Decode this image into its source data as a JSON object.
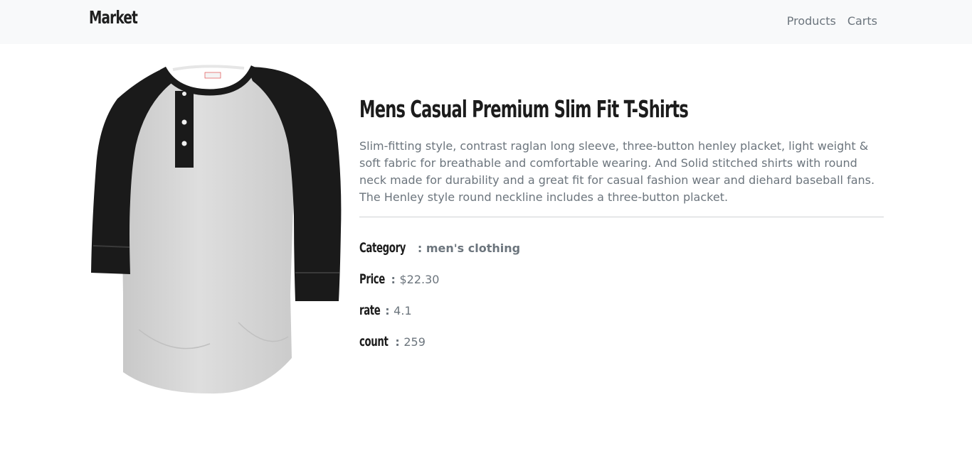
{
  "navbar": {
    "brand": "Market",
    "links": [
      "Products",
      "Carts"
    ]
  },
  "product": {
    "title": "Mens Casual Premium Slim Fit T-Shirts",
    "description": "Slim-fitting style, contrast raglan long sleeve, three-button henley placket, light weight & soft fabric for breathable and comfortable wearing. And Solid stitched shirts with round neck made for durability and a great fit for casual fashion wear and diehard baseball fans. The Henley style round neckline includes a three-button placket.",
    "category_label": "Category",
    "category": "men's clothing",
    "price_label": "Price",
    "price": "$22.30",
    "rate_label": "rate",
    "rate": "4.1",
    "count_label": "count",
    "count": "259",
    "separator": ":",
    "image_icon": "raglan-henley-shirt-image"
  },
  "colors": {
    "navbar_bg": "#f8f9fa",
    "muted_text": "#6c757d",
    "heading_text": "#1c1c1c",
    "shirt_body": "#d9d9d9",
    "shirt_sleeve": "#1a1a1a"
  }
}
